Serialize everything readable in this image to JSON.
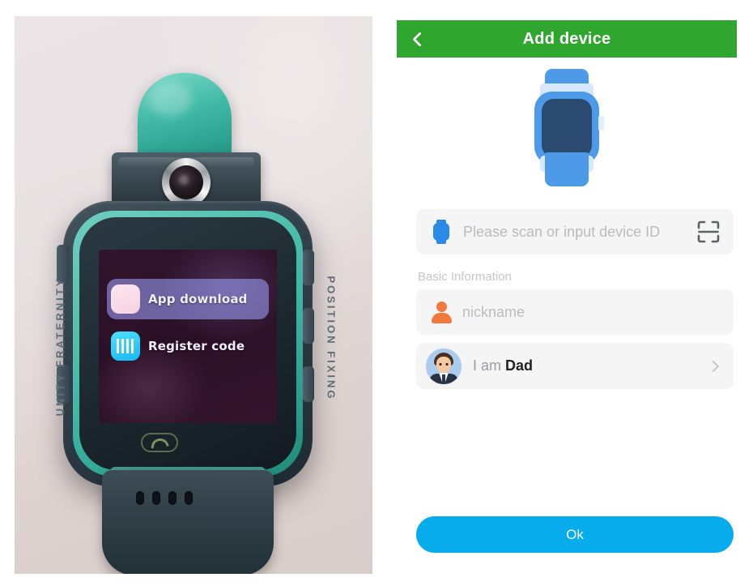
{
  "colors": {
    "appbar_green": "#2fa72e",
    "ok_blue": "#07aced",
    "field_bg": "#f5f5f6",
    "watch_icon_blue": "#4d9ae8",
    "person_icon_orange": "#f2793d"
  },
  "appbar": {
    "back_icon": "chevron-left-icon",
    "title": "Add device"
  },
  "illustration": {
    "icon_name": "smartwatch-illustration"
  },
  "device_field": {
    "icon_name": "watch-icon",
    "placeholder": "Please scan or input device ID",
    "value": "",
    "scan_icon": "qr-scan-icon"
  },
  "basic_information": {
    "section_label": "Basic Information",
    "nickname": {
      "icon_name": "person-icon",
      "placeholder": "nickname",
      "value": ""
    },
    "role": {
      "avatar_name": "dad-avatar",
      "prefix": "I am",
      "value": "Dad",
      "chevron_icon": "chevron-right-icon"
    }
  },
  "footer": {
    "ok_label": "Ok"
  },
  "photo": {
    "caption_name": "smartwatch-photo",
    "watch_screen": {
      "items": [
        {
          "label": "App download",
          "icon": "app-store-icon",
          "selected": true
        },
        {
          "label": "Register code",
          "icon": "barcode-icon",
          "selected": false
        }
      ],
      "hang_up_icon": "hang-up-icon"
    },
    "embossed_left": "UNITY FRATERNITY",
    "embossed_right": "POSITION FIXING"
  }
}
